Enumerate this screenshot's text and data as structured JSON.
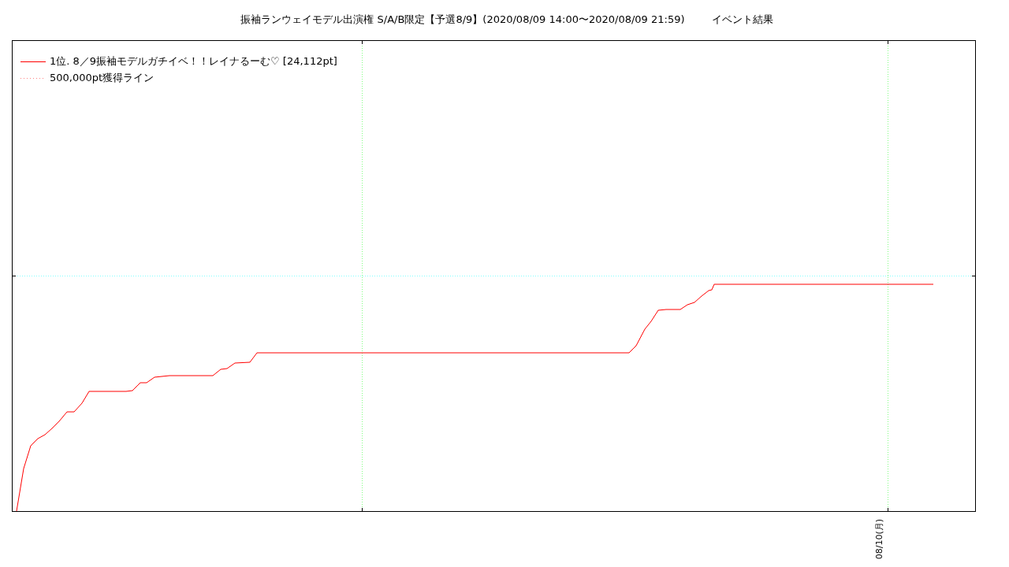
{
  "title": {
    "text": "振袖ランウェイモデル出演権 S/A/B限定【予選8/9】(2020/08/09 14:00〜2020/08/09 21:59)",
    "suffix": "イベント結果"
  },
  "legend": [
    {
      "kind": "solid",
      "label": "1位. 8／9振袖モデルガチイベ！！レイナるーむ♡ [24,112pt]"
    },
    {
      "kind": "dotted",
      "label": "500,000pt獲得ライン"
    }
  ],
  "x_axis": {
    "tick_label": "08/10(月)"
  }
}
